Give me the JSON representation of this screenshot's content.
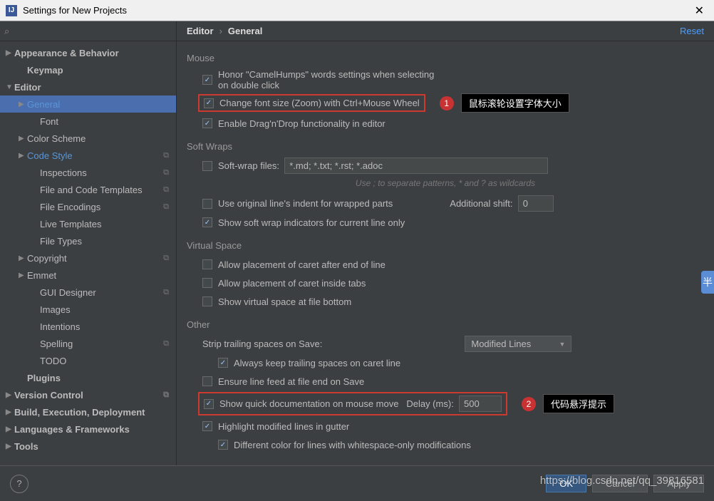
{
  "window": {
    "title": "Settings for New Projects"
  },
  "search": {
    "placeholder": ""
  },
  "sidebar": [
    {
      "label": "Appearance & Behavior",
      "depth": 0,
      "bold": true,
      "arrow": "right"
    },
    {
      "label": "Keymap",
      "depth": 1,
      "bold": true
    },
    {
      "label": "Editor",
      "depth": 0,
      "bold": true,
      "arrow": "down"
    },
    {
      "label": "General",
      "depth": 1,
      "selected": true,
      "arrow": "right",
      "active": true
    },
    {
      "label": "Font",
      "depth": 2
    },
    {
      "label": "Color Scheme",
      "depth": 1,
      "arrow": "right"
    },
    {
      "label": "Code Style",
      "depth": 1,
      "arrow": "right",
      "active": true,
      "copy": true
    },
    {
      "label": "Inspections",
      "depth": 2,
      "copy": true
    },
    {
      "label": "File and Code Templates",
      "depth": 2,
      "copy": true
    },
    {
      "label": "File Encodings",
      "depth": 2,
      "copy": true
    },
    {
      "label": "Live Templates",
      "depth": 2
    },
    {
      "label": "File Types",
      "depth": 2
    },
    {
      "label": "Copyright",
      "depth": 1,
      "arrow": "right",
      "copy": true
    },
    {
      "label": "Emmet",
      "depth": 1,
      "arrow": "right"
    },
    {
      "label": "GUI Designer",
      "depth": 2,
      "copy": true
    },
    {
      "label": "Images",
      "depth": 2
    },
    {
      "label": "Intentions",
      "depth": 2
    },
    {
      "label": "Spelling",
      "depth": 2,
      "copy": true
    },
    {
      "label": "TODO",
      "depth": 2
    },
    {
      "label": "Plugins",
      "depth": 1,
      "bold": true
    },
    {
      "label": "Version Control",
      "depth": 0,
      "bold": true,
      "arrow": "right",
      "copy": true
    },
    {
      "label": "Build, Execution, Deployment",
      "depth": 0,
      "bold": true,
      "arrow": "right"
    },
    {
      "label": "Languages & Frameworks",
      "depth": 0,
      "bold": true,
      "arrow": "right"
    },
    {
      "label": "Tools",
      "depth": 0,
      "bold": true,
      "arrow": "right"
    }
  ],
  "breadcrumb": {
    "a": "Editor",
    "b": "General",
    "reset": "Reset"
  },
  "sections": {
    "mouse": {
      "title": "Mouse",
      "honor": "Honor \"CamelHumps\" words settings when selecting on double click",
      "zoom": "Change font size (Zoom) with Ctrl+Mouse Wheel",
      "dnd": "Enable Drag'n'Drop functionality in editor",
      "callout1_num": "1",
      "callout1_text": "鼠标滚轮设置字体大小"
    },
    "softwraps": {
      "title": "Soft Wraps",
      "swfiles": "Soft-wrap files:",
      "swvalue": "*.md; *.txt; *.rst; *.adoc",
      "hint": "Use ; to separate patterns, * and ? as wildcards",
      "indent": "Use original line's indent for wrapped parts",
      "shift_label": "Additional shift:",
      "shift_value": "0",
      "indicators": "Show soft wrap indicators for current line only"
    },
    "virtual": {
      "title": "Virtual Space",
      "eol": "Allow placement of caret after end of line",
      "tabs": "Allow placement of caret inside tabs",
      "bottom": "Show virtual space at file bottom"
    },
    "other": {
      "title": "Other",
      "strip_label": "Strip trailing spaces on Save:",
      "strip_value": "Modified Lines",
      "keep": "Always keep trailing spaces on caret line",
      "lf": "Ensure line feed at file end on Save",
      "quickdoc": "Show quick documentation on mouse move",
      "delay_label": "Delay (ms):",
      "delay_value": "500",
      "callout2_num": "2",
      "callout2_text": "代码悬浮提示",
      "hl": "Highlight modified lines in gutter",
      "diffcolor": "Different color for lines with whitespace-only modifications"
    }
  },
  "footer": {
    "ok": "OK",
    "cancel": "Cancel",
    "apply": "Apply"
  },
  "watermark": "https://blog.csdn.net/qq_39816581",
  "cut": "半"
}
